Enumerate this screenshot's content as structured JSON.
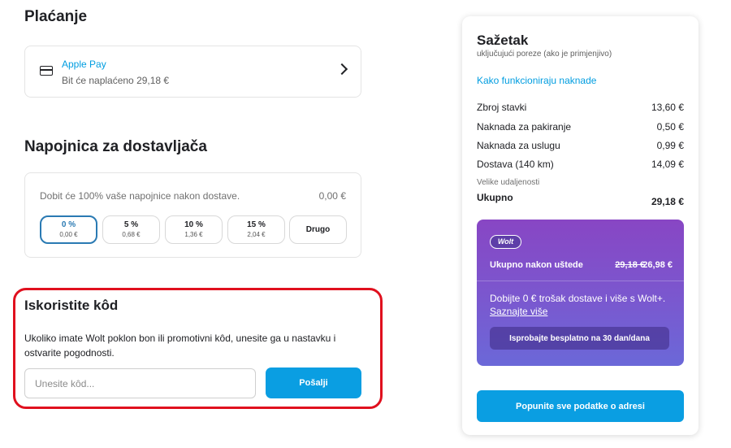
{
  "payment": {
    "heading": "Plaćanje",
    "method_name": "Apple Pay",
    "charge_note": "Bit će naplaćeno 29,18 €",
    "icon": "credit-card-icon"
  },
  "tip": {
    "heading": "Napojnica za dostavljača",
    "info": "Dobit će 100% vaše napojnice nakon dostave.",
    "amount": "0,00 €",
    "options": [
      {
        "percent": "0 %",
        "amount": "0,00 €"
      },
      {
        "percent": "5 %",
        "amount": "0,68 €"
      },
      {
        "percent": "10 %",
        "amount": "1,36 €"
      },
      {
        "percent": "15 %",
        "amount": "2,04 €"
      }
    ],
    "other_label": "Drugo"
  },
  "code": {
    "heading": "Iskoristite kôd",
    "description": "Ukoliko imate Wolt poklon bon ili promotivni kôd, unesite ga u nastavku i ostvarite pogodnosti.",
    "placeholder": "Unesite kôd...",
    "value": "",
    "submit_label": "Pošalji",
    "highlight_color": "#e0101e"
  },
  "summary": {
    "title": "Sažetak",
    "subtitle": "uključujući poreze (ako je primjenjivo)",
    "fees_link": "Kako funkcioniraju naknade",
    "rows": [
      {
        "label": "Zbroj stavki",
        "value": "13,60 €"
      },
      {
        "label": "Naknada za pakiranje",
        "value": "0,50 €"
      },
      {
        "label": "Naknada za uslugu",
        "value": "0,99 €"
      },
      {
        "label": "Dostava (140 km)",
        "value": "14,09 €"
      }
    ],
    "distance_note": "Velike udaljenosti",
    "total_label": "Ukupno",
    "total_value": "29,18 €",
    "promo": {
      "logo": "Wolt",
      "after_savings_label": "Ukupno nakon uštede",
      "old_price": "29,18 €",
      "new_price": "26,98 €",
      "plus_text": "Dobijte 0 € trošak dostave i više s Wolt+.",
      "learn_more": "Saznajte više",
      "trial_label": "Isprobajte besplatno na 30 dan/dana"
    },
    "address_button": "Popunite sve podatke o adresi"
  },
  "colors": {
    "accent": "#009de0",
    "button": "#0a9ee2",
    "promo_gradient": [
      "#8846c4",
      "#6b68d8"
    ]
  }
}
